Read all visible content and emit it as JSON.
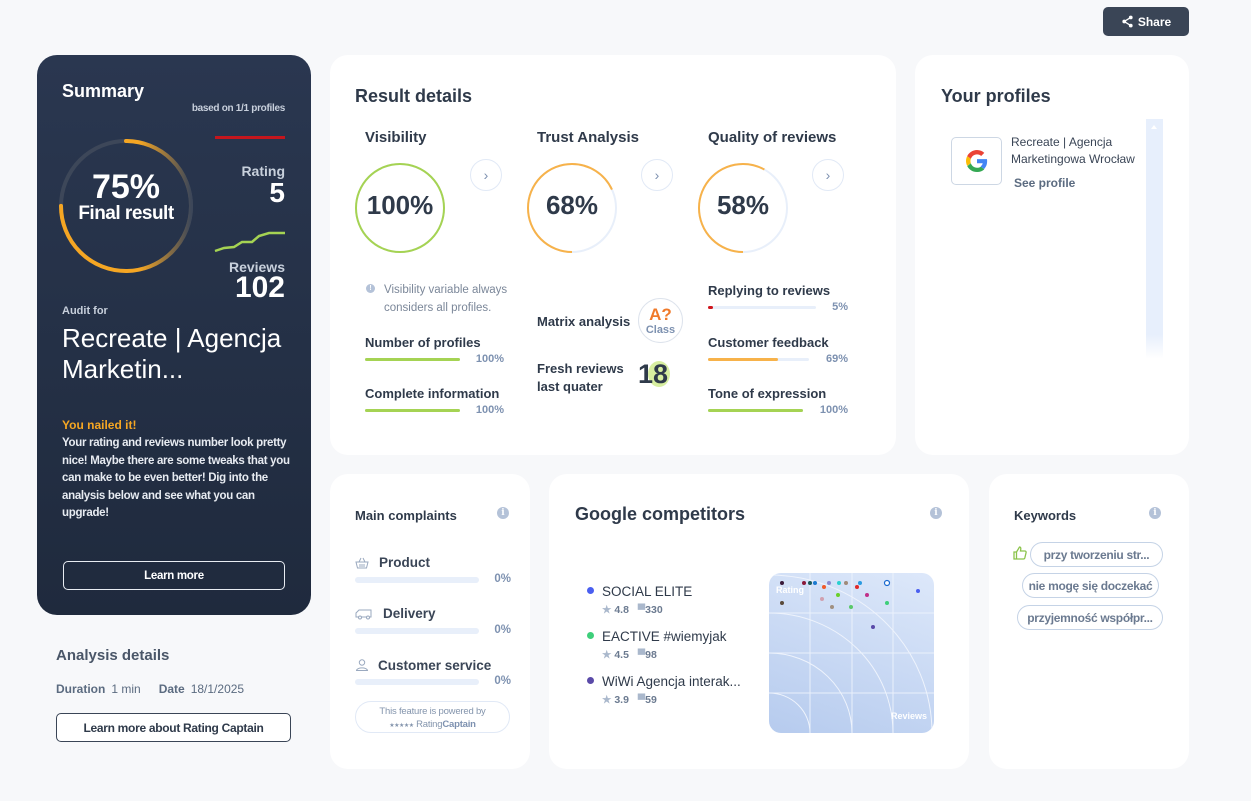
{
  "share": {
    "label": "Share"
  },
  "summary": {
    "title": "Summary",
    "based_on": "based on 1/1 profiles",
    "final_percent": "75%",
    "final_value": 0.75,
    "final_label": "Final result",
    "rating_label": "Rating",
    "rating_value": "5",
    "reviews_label": "Reviews",
    "reviews_value": "102",
    "audit_for": "Audit for",
    "business_name": "Recreate | Agencja Marketin...",
    "nailed": "You nailed it!",
    "description": "Your rating and reviews number look pretty nice! Maybe there are some tweaks that you can make to be even better! Dig into the analysis below and see what you can upgrade!",
    "learn_more": "Learn more"
  },
  "analysis": {
    "title": "Analysis details",
    "duration_label": "Duration",
    "duration_value": "1 min",
    "date_label": "Date",
    "date_value": "18/1/2025",
    "learn_more_rc": "Learn more about Rating Captain"
  },
  "result": {
    "title": "Result details",
    "visibility": {
      "title": "Visibility",
      "percent": "100%",
      "value": 1.0,
      "note": "Visibility variable always considers all profiles.",
      "metrics": [
        {
          "label": "Number of profiles",
          "percent": "100%",
          "value": 1.0
        },
        {
          "label": "Complete information",
          "percent": "100%",
          "value": 1.0
        }
      ]
    },
    "trust": {
      "title": "Trust Analysis",
      "percent": "68%",
      "value": 0.68,
      "matrix_label": "Matrix analysis",
      "class_grade": "A?",
      "class_label": "Class",
      "fresh_label": "Fresh reviews last quater",
      "fresh_value": "18"
    },
    "quality": {
      "title": "Quality of reviews",
      "percent": "58%",
      "value": 0.58,
      "metrics": [
        {
          "label": "Replying to reviews",
          "percent": "5%",
          "value": 0.05,
          "color": "#d0161d"
        },
        {
          "label": "Customer feedback",
          "percent": "69%",
          "value": 0.69,
          "color": "#f7b24a"
        },
        {
          "label": "Tone of expression",
          "percent": "100%",
          "value": 1.0,
          "color": "#a5d353"
        }
      ]
    }
  },
  "profiles": {
    "title": "Your profiles",
    "items": [
      {
        "icon": "google-icon",
        "name": "Recreate | Agencja Marketingowa Wrocław",
        "link": "See profile"
      }
    ]
  },
  "complaints": {
    "title": "Main complaints",
    "items": [
      {
        "icon": "basket-icon",
        "label": "Product",
        "percent": "0%",
        "value": 0
      },
      {
        "icon": "van-icon",
        "label": "Delivery",
        "percent": "0%",
        "value": 0
      },
      {
        "icon": "user-icon",
        "label": "Customer service",
        "percent": "0%",
        "value": 0
      }
    ],
    "powered_line1": "This feature is powered by",
    "powered_stars": "★★★★★",
    "powered_brand_a": "Rating",
    "powered_brand_b": "Captain"
  },
  "competitors": {
    "title": "Google competitors",
    "items": [
      {
        "name": "SOCIAL ELITE",
        "rating": "4.8",
        "reviews": "330",
        "color": "#4a5ff0"
      },
      {
        "name": "EACTIVE #wiemyjak",
        "rating": "4.5",
        "reviews": "98",
        "color": "#3ecf7a"
      },
      {
        "name": "WiWi Agencja interak...",
        "rating": "3.9",
        "reviews": "59",
        "color": "#5a4aa8"
      }
    ],
    "plot": {
      "y_label": "Rating",
      "x_label": "Reviews",
      "points": [
        {
          "color": "#3a1a3a"
        },
        {
          "color": "#8a1a3a"
        },
        {
          "color": "#1a5a5a"
        },
        {
          "color": "#1a7ad0"
        },
        {
          "color": "#8a8ad0"
        },
        {
          "color": "#2ad0d0"
        },
        {
          "color": "#a08a7a"
        },
        {
          "color": "#2a9ae0"
        },
        {
          "color": "#f05a2a"
        },
        {
          "color": "#e02a2a"
        },
        {
          "color": "#c0308a"
        },
        {
          "color": "#4a5ff0"
        },
        {
          "color": "#d0a0b0"
        },
        {
          "color": "#6ad02a"
        },
        {
          "color": "#5a4a3a"
        },
        {
          "color": "#a09080"
        },
        {
          "color": "#5ac86a"
        },
        {
          "color": "#3ecf7a"
        },
        {
          "color": "#5a4aa8"
        }
      ]
    }
  },
  "keywords": {
    "title": "Keywords",
    "items": [
      "przy tworzeniu str...",
      "nie mogę się doczekać",
      "przyjemność współpr..."
    ]
  }
}
